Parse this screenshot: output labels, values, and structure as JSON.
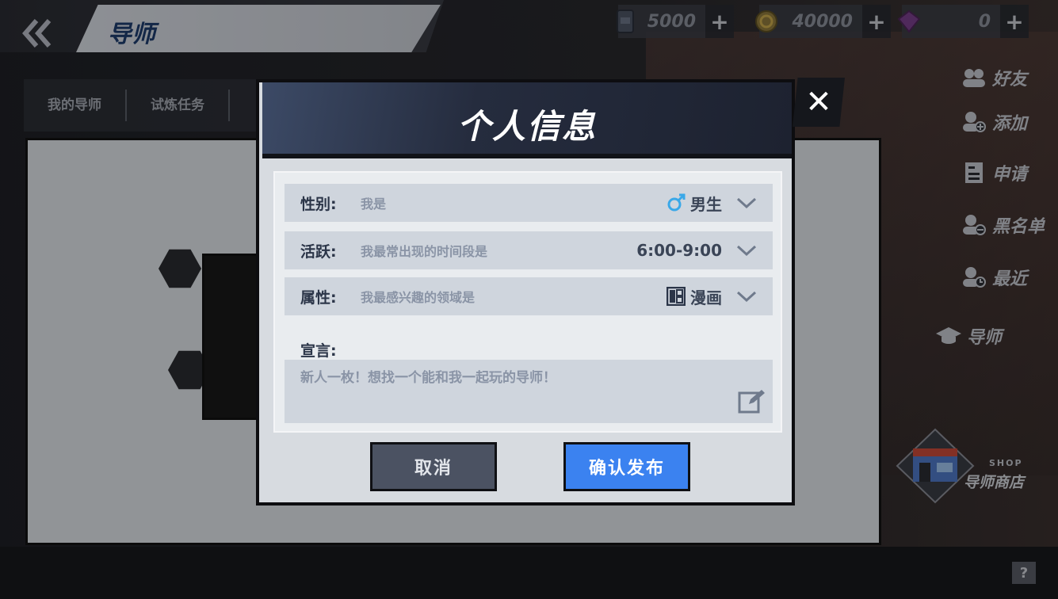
{
  "header": {
    "back_icon": "double-chevron-left-icon",
    "title": "导师"
  },
  "currencies": [
    {
      "icon": "ticket-icon",
      "value": "5000",
      "plus": "+"
    },
    {
      "icon": "coin-icon",
      "value": "40000",
      "plus": "+"
    },
    {
      "icon": "gem-icon",
      "value": "0",
      "plus": "+"
    }
  ],
  "tabs": [
    "我的导师",
    "试炼任务"
  ],
  "side_menu": [
    {
      "icon": "friends-icon",
      "label": "好友"
    },
    {
      "icon": "add-friend-icon",
      "label": "添加"
    },
    {
      "icon": "application-icon",
      "label": "申请"
    },
    {
      "icon": "blacklist-icon",
      "label": "黑名单"
    },
    {
      "icon": "recent-icon",
      "label": "最近"
    },
    {
      "icon": "mortarboard-icon",
      "label": "导师"
    }
  ],
  "shop": {
    "tag": "SHOP",
    "label": "导师商店"
  },
  "help": "?",
  "modal": {
    "title": "个人信息",
    "close": "✕",
    "rows": [
      {
        "label": "性别:",
        "desc": "我是",
        "value": "男生",
        "icon": "male-icon"
      },
      {
        "label": "活跃:",
        "desc": "我最常出现的时间段是",
        "value": "6:00-9:00",
        "icon": ""
      },
      {
        "label": "属性:",
        "desc": "我最感兴趣的领域是",
        "value": "漫画",
        "icon": "comic-icon"
      }
    ],
    "declaration_label": "宣言:",
    "declaration_text": "新人一枚！想找一个能和我一起玩的导师！",
    "cancel": "取消",
    "confirm": "确认发布"
  },
  "colors": {
    "accent_blue": "#3b82f0",
    "male_blue": "#3aa8e8",
    "title_blue": "#1e3c6e"
  }
}
